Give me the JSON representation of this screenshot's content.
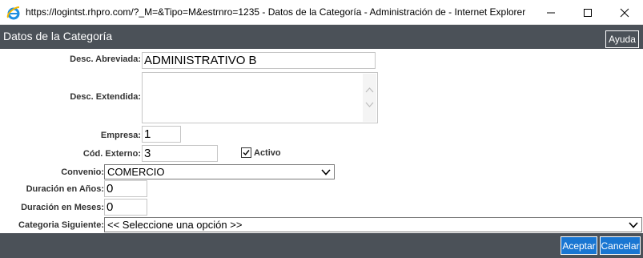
{
  "window": {
    "title": "https://logintst.rhpro.com/?_M=&Tipo=M&estrnro=1235 - Datos de la Categoría - Administración de - Internet Explorer",
    "icon": "internet-explorer-icon"
  },
  "header": {
    "title": "Datos de la Categoría",
    "help_label": "Ayuda",
    "background": "#4b5158"
  },
  "form": {
    "desc_abreviada": {
      "label": "Desc. Abreviada:",
      "value": "ADMINISTRATIVO B"
    },
    "desc_extendida": {
      "label": "Desc. Extendida:",
      "value": ""
    },
    "empresa": {
      "label": "Empresa:",
      "value": "1"
    },
    "cod_externo": {
      "label": "Cód. Externo:",
      "value": "3"
    },
    "activo": {
      "label": "Activo",
      "checked": true
    },
    "convenio": {
      "label": "Convenio:",
      "value": "COMERCIO"
    },
    "duracion_anios": {
      "label": "Duración en Años:",
      "value": "0"
    },
    "duracion_meses": {
      "label": "Duración en Meses:",
      "value": "0"
    },
    "categoria_siguiente": {
      "label": "Categoria Siguiente:",
      "value": "<< Seleccione una opción >>"
    }
  },
  "footer": {
    "accept_label": "Aceptar",
    "cancel_label": "Cancelar",
    "button_color": "#1976d2"
  }
}
